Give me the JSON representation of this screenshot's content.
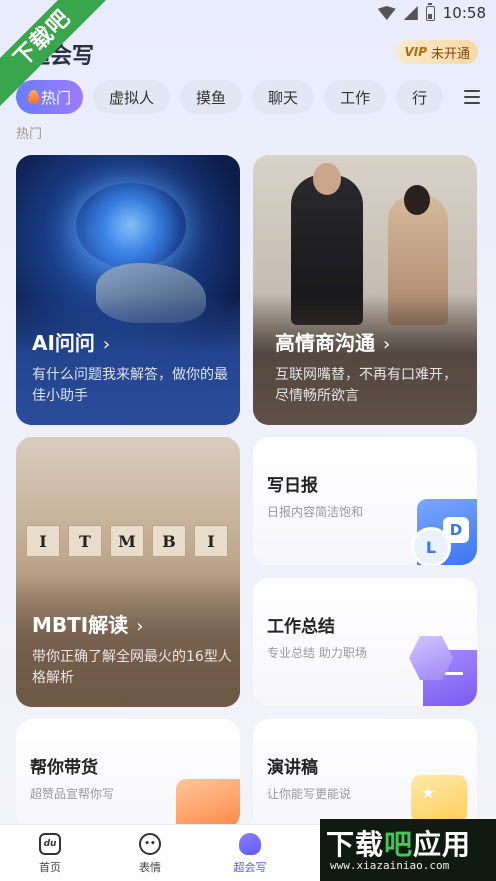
{
  "status_bar": {
    "time": "10:58"
  },
  "watermark": {
    "ribbon": "下载吧",
    "box_title_a": "下载",
    "box_title_b": "吧",
    "box_title_c": "应用",
    "url": "www.xiazainiao.com"
  },
  "header": {
    "app_title": "超会写",
    "vip_badge": "VIP",
    "vip_label": "未开通"
  },
  "tabs": [
    {
      "label": "热门",
      "active": true
    },
    {
      "label": "虚拟人"
    },
    {
      "label": "摸鱼"
    },
    {
      "label": "聊天"
    },
    {
      "label": "工作"
    },
    {
      "label": "行"
    }
  ],
  "section_label": "热门",
  "cards": {
    "ai": {
      "title": "AI问问",
      "desc": "有什么问题我来解答，做你的最佳小助手"
    },
    "eq": {
      "title": "高情商沟通",
      "desc": "互联网嘴替，不再有口难开，尽情畅所欲言"
    },
    "mbti": {
      "title": "MBTI解读",
      "desc": "带你正确了解全网最火的16型人格解析",
      "blocks": [
        "I",
        "T",
        "M",
        "B",
        "I"
      ]
    },
    "daily": {
      "title": "写日报",
      "desc": "日报内容简洁饱和"
    },
    "summary": {
      "title": "工作总结",
      "desc": "专业总结 助力职场"
    },
    "goods": {
      "title": "帮你带货",
      "desc": "超赞品宣帮你写"
    },
    "speech": {
      "title": "演讲稿",
      "desc": "让你能写更能说"
    }
  },
  "bottom_nav": [
    {
      "label": "首页",
      "icon": "home-icon",
      "glyph": "du"
    },
    {
      "label": "表情",
      "icon": "emoji-icon"
    },
    {
      "label": "超会写",
      "icon": "write-icon",
      "active": true
    }
  ],
  "colors": {
    "accent": "#5d5bf0",
    "tab_active_start": "#6a7cff",
    "watermark_green": "#3aa64b"
  }
}
